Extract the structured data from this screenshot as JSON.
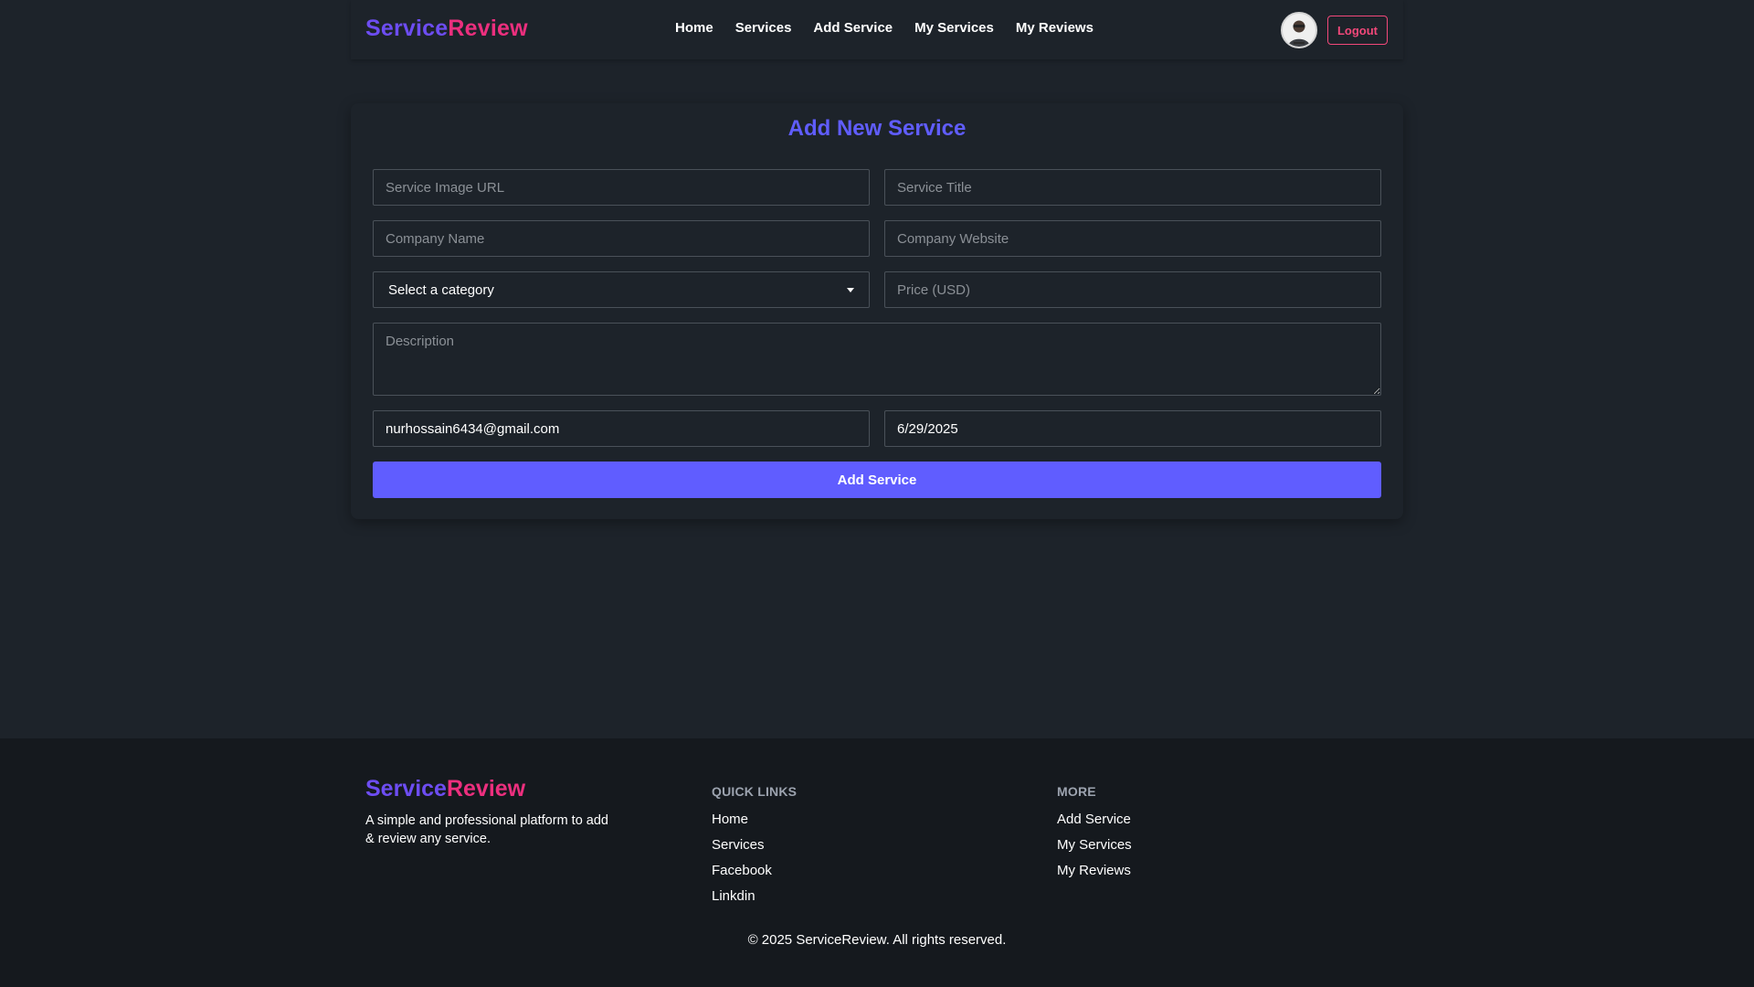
{
  "brand": {
    "part1": "Service",
    "part2": "Review"
  },
  "nav": {
    "links": [
      "Home",
      "Services",
      "Add Service",
      "My Services",
      "My Reviews"
    ],
    "logout_label": "Logout"
  },
  "form": {
    "title": "Add New Service",
    "image_url_placeholder": "Service Image URL",
    "title_placeholder": "Service Title",
    "company_name_placeholder": "Company Name",
    "company_website_placeholder": "Company Website",
    "category_selected": "Select a category",
    "price_placeholder": "Price (USD)",
    "description_placeholder": "Description",
    "email_value": "nurhossain6434@gmail.com",
    "date_value": "6/29/2025",
    "submit_label": "Add Service"
  },
  "footer": {
    "description": "A simple and professional platform to add & review any service.",
    "quick_links_heading": "QUICK LINKS",
    "quick_links": [
      "Home",
      "Services",
      "Facebook",
      "Linkdin"
    ],
    "more_heading": "MORE",
    "more_links": [
      "Add Service",
      "My Services",
      "My Reviews"
    ],
    "copyright": "© 2025 ServiceReview. All rights reserved."
  },
  "colors": {
    "accent": "#605dff",
    "brand_purple": "#6d4df2",
    "brand_pink": "#ec2f7e",
    "logout": "#f2487a",
    "background": "#1d232a",
    "footer_bg": "#15191e"
  },
  "icons": [
    "avatar",
    "chevron-down-icon"
  ]
}
